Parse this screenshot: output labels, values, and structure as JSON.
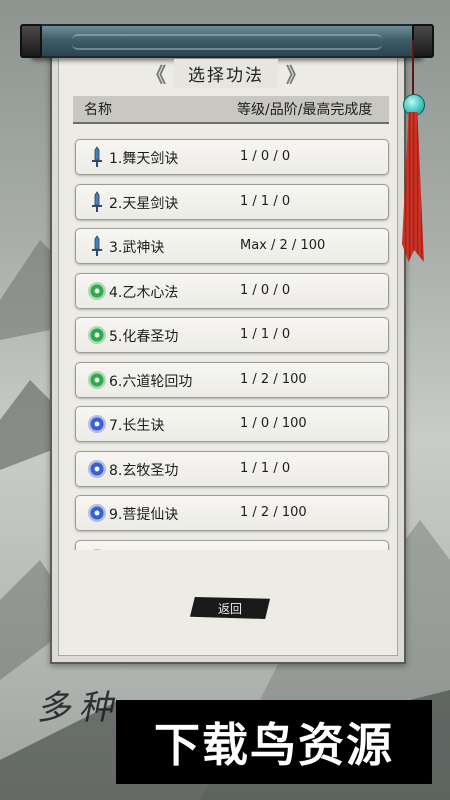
{
  "title": "选择功法",
  "title_left_bracket": "《",
  "title_right_bracket": "》",
  "header": {
    "name_col": "名称",
    "info_col": "等级/品阶/最高完成度"
  },
  "skills": [
    {
      "name": "1.舞天剑诀",
      "info": "1 / 0 / 0",
      "icon": "sword-icon"
    },
    {
      "name": "2.天星剑诀",
      "info": "1 / 1 / 0",
      "icon": "sword-icon"
    },
    {
      "name": "3.武神诀",
      "info": "Max / 2 / 100",
      "icon": "sword-icon"
    },
    {
      "name": "4.乙木心法",
      "info": "1 / 0 / 0",
      "icon": "green-orb-icon"
    },
    {
      "name": "5.化春圣功",
      "info": "1 / 1 / 0",
      "icon": "green-orb-icon"
    },
    {
      "name": "6.六道轮回功",
      "info": "1 / 2 / 100",
      "icon": "green-orb-icon"
    },
    {
      "name": "7.长生诀",
      "info": "1 / 0 / 100",
      "icon": "blue-orb-icon"
    },
    {
      "name": "8.玄牧圣功",
      "info": "1 / 1 / 0",
      "icon": "blue-orb-icon"
    },
    {
      "name": "9.菩提仙诀",
      "info": "1 / 2 / 100",
      "icon": "blue-orb-icon"
    }
  ],
  "back_button": "返回",
  "bottom_text": "多种",
  "watermark": "下载鸟资源",
  "colors": {
    "sword": "#4a7fb5",
    "green_orb": "#2fa84f",
    "blue_orb": "#3b5fd1",
    "red_orb": "#d23a2a",
    "tassel_red": "#c22e22",
    "bead_cyan": "#3ccac0"
  }
}
